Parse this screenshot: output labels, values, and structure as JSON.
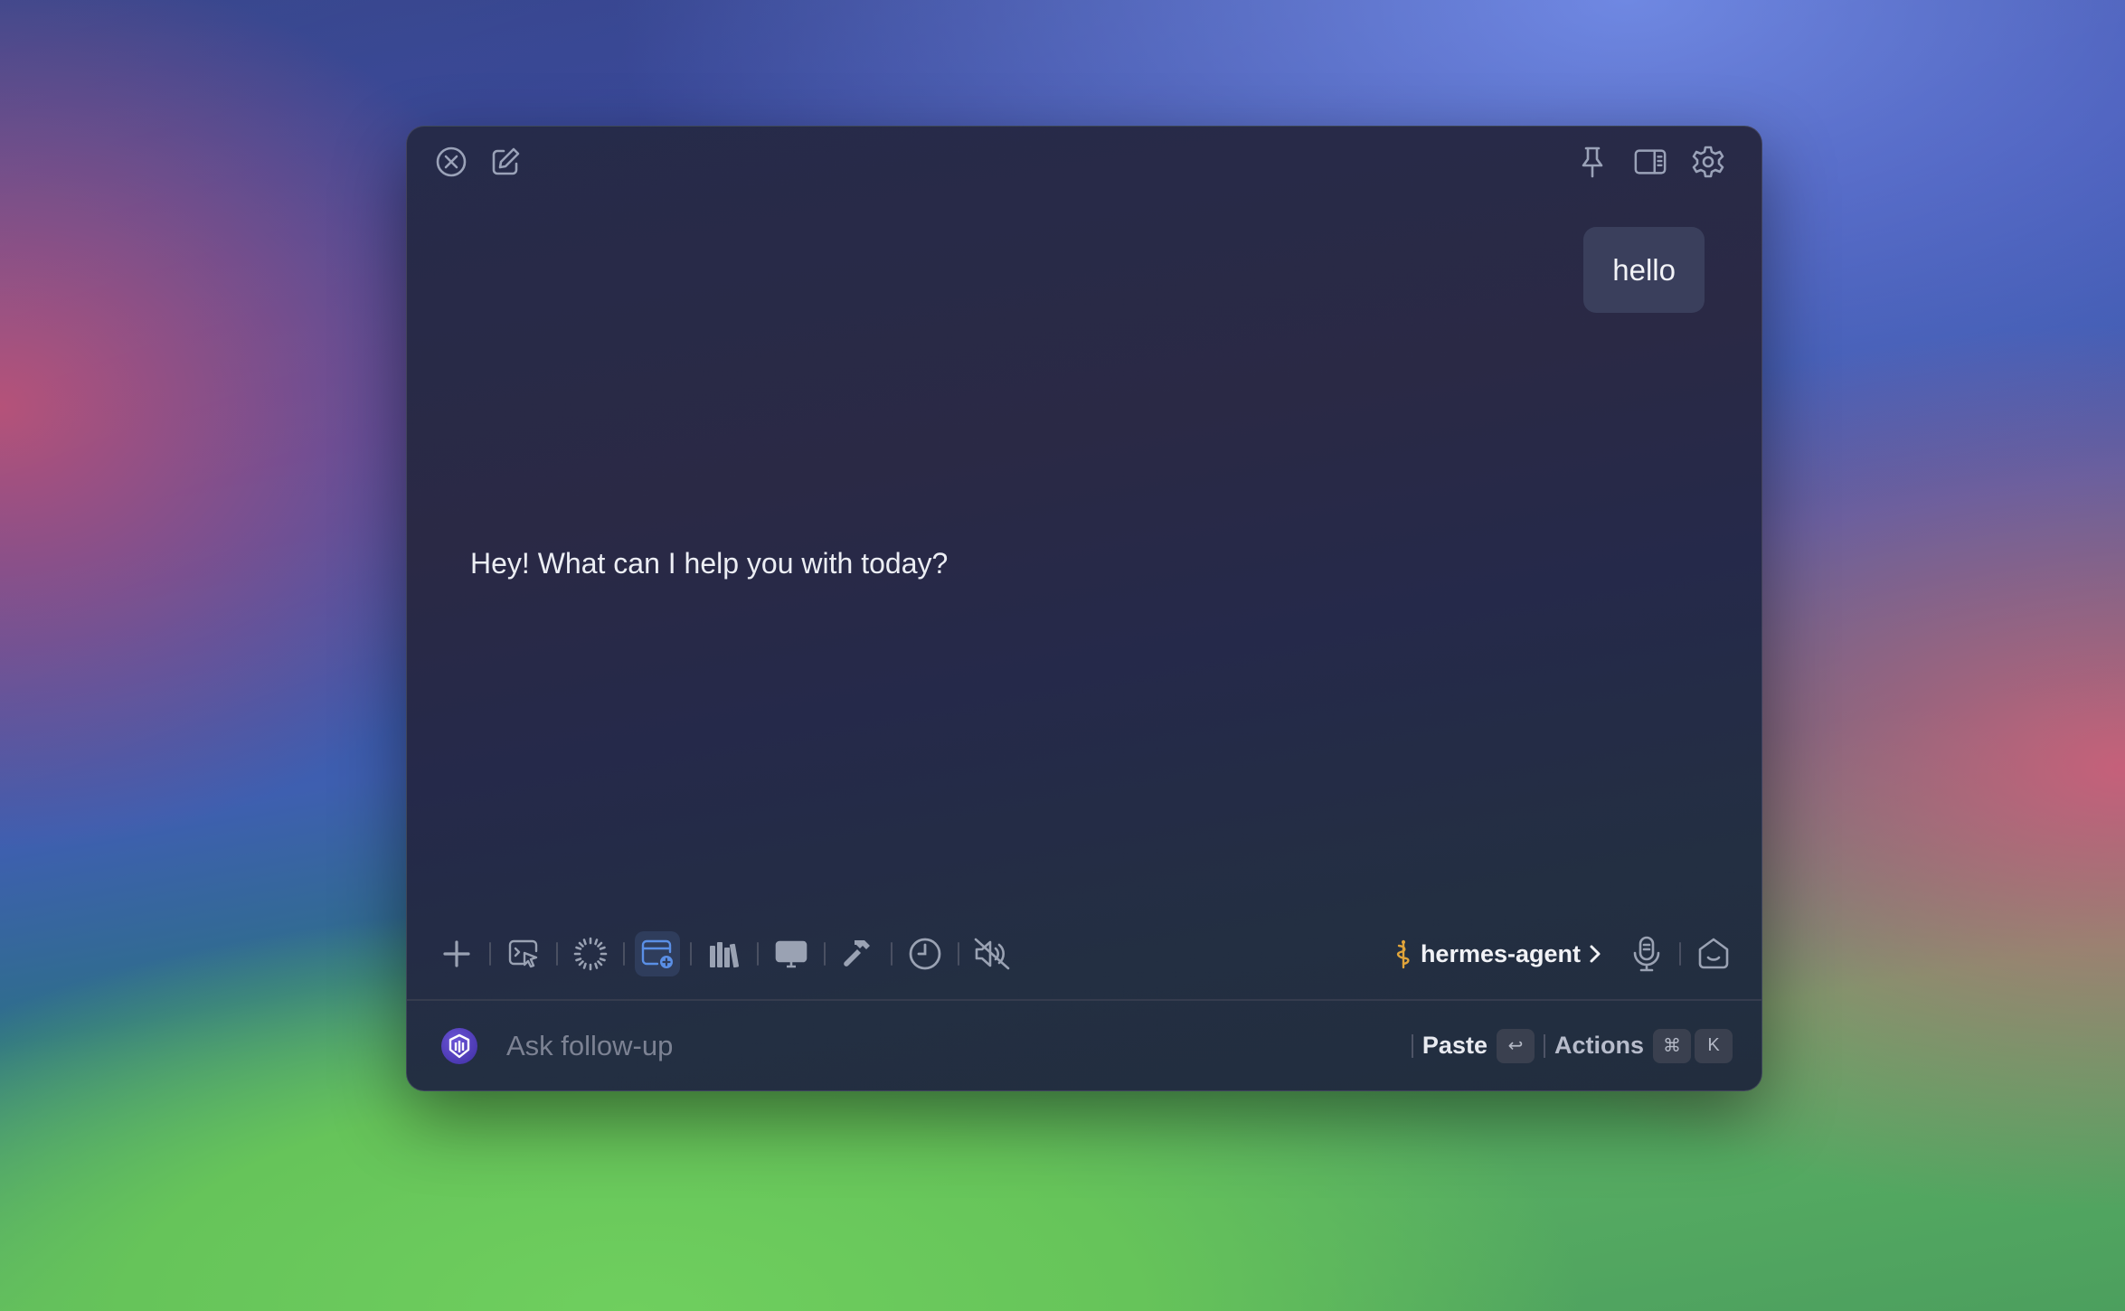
{
  "window": {
    "top_icons_left": [
      "close-icon",
      "compose-icon"
    ],
    "top_icons_right": [
      "pin-icon",
      "sidebar-icon",
      "gear-icon"
    ]
  },
  "conversation": {
    "user_message": "hello",
    "assistant_message": "Hey! What can I help you with today?"
  },
  "toolbar": {
    "tools": [
      "plus-icon",
      "screen-select-icon",
      "loading-icon",
      "new-window-icon",
      "library-icon",
      "monitor-icon",
      "hammer-icon",
      "clock-icon",
      "speaker-muted-icon"
    ],
    "active_tool": "new-window-icon",
    "agent_name": "hermes-agent",
    "agent_icon": "staff-icon",
    "agent_icon_color": "#e0a43a",
    "right_icons": [
      "microphone-icon",
      "home-face-icon"
    ]
  },
  "input": {
    "placeholder": "Ask follow-up",
    "paste_label": "Paste",
    "paste_key": "↩",
    "actions_label": "Actions",
    "actions_keys": [
      "⌘",
      "K"
    ]
  },
  "colors": {
    "active_tool": "#5a8fe6",
    "window_bg": "#262b4a",
    "logo": "#5a46c8"
  }
}
